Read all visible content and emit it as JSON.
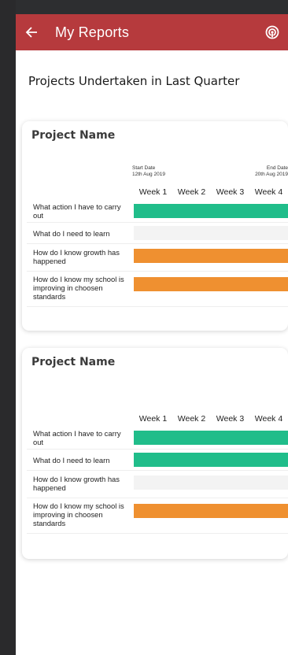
{
  "header": {
    "title": "My Reports",
    "back_icon": "arrow-left-icon",
    "action_icon": "podcast-icon"
  },
  "colors": {
    "app_bar": "#b63a3d",
    "green": "#20bd8a",
    "orange": "#ef9030",
    "empty": "#f3f3f3"
  },
  "section_title": "Projects Undertaken in Last Quarter",
  "cards": [
    {
      "title": "Project Name",
      "start_label": "Start Date",
      "start_date": "12th Aug 2019",
      "end_label": "End Date",
      "end_date": "20th Aug 2019",
      "weeks": [
        "Week 1",
        "Week 2",
        "Week 3",
        "Week 4"
      ],
      "rows": [
        {
          "label": "What action I have to carry out",
          "status": "green",
          "progress": 1.0
        },
        {
          "label": "What do I need to learn",
          "status": "empty",
          "progress": 0
        },
        {
          "label": "How do I know growth has happened",
          "status": "orange",
          "progress": 1.0
        },
        {
          "label": "How do I know my school is improving in choosen standards",
          "status": "orange",
          "progress": 1.0
        }
      ]
    },
    {
      "title": "Project Name",
      "weeks": [
        "Week 1",
        "Week 2",
        "Week 3",
        "Week 4"
      ],
      "rows": [
        {
          "label": "What action I have to carry out",
          "status": "green",
          "progress": 1.0
        },
        {
          "label": "What do I need to learn",
          "status": "green",
          "progress": 1.0
        },
        {
          "label": "How do I know growth has happened",
          "status": "empty",
          "progress": 0
        },
        {
          "label": "How do I know my school is improving in choosen standards",
          "status": "orange",
          "progress": 1.0
        }
      ]
    }
  ]
}
